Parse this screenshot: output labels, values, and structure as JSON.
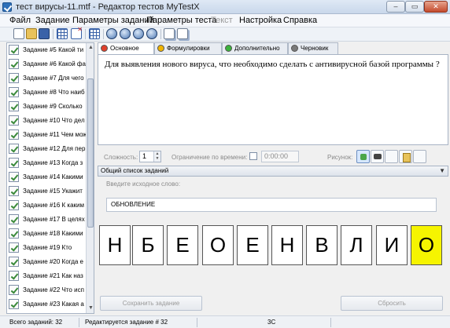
{
  "window": {
    "title": "тест вирусы-11.mtf - Редактор тестов MyTestX",
    "min": "–",
    "max": "▭",
    "close": "✕"
  },
  "menu": [
    {
      "label": "Файл",
      "disabled": false
    },
    {
      "label": "Задание",
      "disabled": false
    },
    {
      "label": "Параметры заданий",
      "disabled": false
    },
    {
      "label": "Параметры теста",
      "disabled": false
    },
    {
      "label": "Текст",
      "disabled": true
    },
    {
      "label": "Настройка",
      "disabled": false
    },
    {
      "label": "Справка",
      "disabled": false
    }
  ],
  "toolbar_icons": [
    "new-file-icon",
    "open-folder-icon",
    "save-icon",
    "add-task-icon",
    "delete-task-icon",
    "task-grid-icon",
    "nav-first-icon",
    "nav-prev-icon",
    "nav-next-icon",
    "nav-last-icon",
    "copy-icon",
    "paste-icon"
  ],
  "tasks": [
    {
      "label": "Задание #5 Какой ти"
    },
    {
      "label": "Задание #6 Какой фа"
    },
    {
      "label": "Задание #7 Для чего"
    },
    {
      "label": "Задание #8 Что наиб"
    },
    {
      "label": "Задание #9 Сколько"
    },
    {
      "label": "Задание #10 Что дел"
    },
    {
      "label": "Задание #11 Чем мож"
    },
    {
      "label": "Задание #12 Для пер"
    },
    {
      "label": "Задание #13 Когда з"
    },
    {
      "label": "Задание #14 Какими"
    },
    {
      "label": "Задание #15 Укажит"
    },
    {
      "label": "Задание #16 К каким"
    },
    {
      "label": "Задание #17 В целях"
    },
    {
      "label": "Задание #18 Какими"
    },
    {
      "label": "Задание #19 Кто"
    },
    {
      "label": "Задание #20 Когда е"
    },
    {
      "label": "Задание #21 Как наз"
    },
    {
      "label": "Задание #22 Что исп"
    },
    {
      "label": "Задание #23 Какая а"
    }
  ],
  "tabs": [
    {
      "label": "Основное",
      "color": "#e0402c"
    },
    {
      "label": "Формулировки",
      "color": "#f0b400"
    },
    {
      "label": "Дополнительно",
      "color": "#3bb23b"
    },
    {
      "label": "Черновик",
      "color": "#7a7a7a"
    }
  ],
  "question": {
    "text": "Для выявления нового вируса, что необходимо сделать с антивирусной базой программы ?"
  },
  "options": {
    "difficulty_label": "Сложность:",
    "difficulty_value": "1",
    "time_limit_label": "Ограничение по времени:",
    "time_value": "0:00:00",
    "picture_label": "Рисунок:"
  },
  "dropdown": {
    "label": "Общий список заданий"
  },
  "answer": {
    "hint": "Введите исходное слово:",
    "word": "ОБНОВЛЕНИЕ",
    "letters": [
      "Н",
      "Б",
      "Е",
      "О",
      "Е",
      "Н",
      "В",
      "Л",
      "И",
      "О"
    ],
    "highlight_index": 9,
    "highlight_color": "#f6f400"
  },
  "buttons": {
    "save": "Сохранить задание",
    "reset": "Сбросить"
  },
  "status": {
    "total": "Всего заданий: 32",
    "editing": "Редактируется задание # 32",
    "code": "3С"
  }
}
